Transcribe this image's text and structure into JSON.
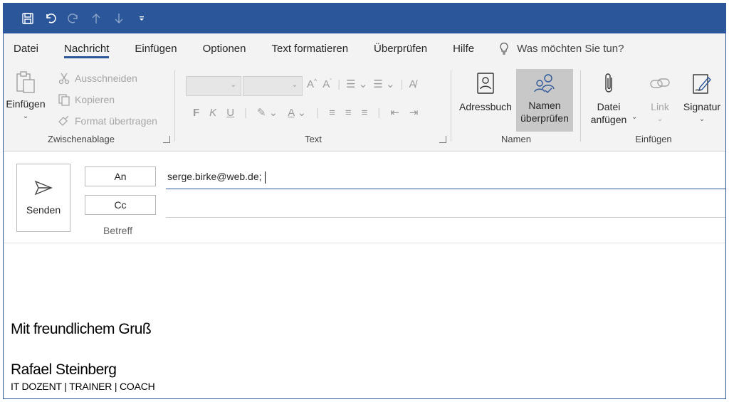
{
  "tabs": [
    "Datei",
    "Nachricht",
    "Einfügen",
    "Optionen",
    "Text formatieren",
    "Überprüfen",
    "Hilfe"
  ],
  "active_tab": "Nachricht",
  "tell_me": "Was möchten Sie tun?",
  "ribbon": {
    "clipboard": {
      "paste": "Einfügen",
      "cut": "Ausschneiden",
      "copy": "Kopieren",
      "format_painter": "Format übertragen",
      "label": "Zwischenablage"
    },
    "text": {
      "bold": "F",
      "italic": "K",
      "underline": "U",
      "label": "Text"
    },
    "names": {
      "address_book": "Adressbuch",
      "check_names_line1": "Namen",
      "check_names_line2": "überprüfen",
      "label": "Namen"
    },
    "include": {
      "attach_line1": "Datei",
      "attach_line2": "anfügen",
      "link": "Link",
      "signature": "Signatur",
      "label": "Einfügen"
    }
  },
  "compose": {
    "send": "Senden",
    "to_button": "An",
    "cc_button": "Cc",
    "subject_label": "Betreff",
    "to_value": "serge.birke@web.de;"
  },
  "body": {
    "greeting": "Mit freundlichem Gruß",
    "signature_name": "Rafael Steinberg",
    "signature_title": "IT DOZENT | TRAINER | COACH"
  },
  "colors": {
    "accent": "#2b579a",
    "ribbon_bg": "#f3f3f3",
    "hover_bg": "#c8c8c8"
  }
}
